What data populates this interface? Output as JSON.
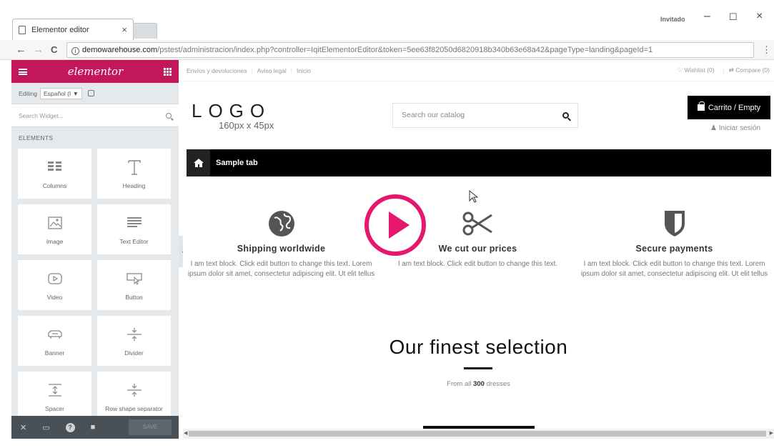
{
  "browser": {
    "tab_title": "Elementor editor",
    "tab_close": "×",
    "user_label": "Invitado",
    "window_minimize": "–",
    "window_maximize": "☐",
    "window_close": "×",
    "back": "←",
    "forward": "→",
    "reload": "C",
    "url_host": "demowarehouse.com",
    "url_path": "/pstest/administracion/index.php?controller=IqitElementorEditor&token=5ee63f82050d6820918b340b63e68a42&pageType=landing&pageId=1",
    "menu": "⋮"
  },
  "panel": {
    "brand": "elementor",
    "editing_label": "Editing",
    "language": "Español (I ▼",
    "search_placeholder": "Search Widget...",
    "section_title": "ELEMENTS",
    "widgets": [
      {
        "label": "Columns",
        "icon": "columns-icon"
      },
      {
        "label": "Heading",
        "icon": "heading-icon"
      },
      {
        "label": "Image",
        "icon": "image-icon"
      },
      {
        "label": "Text Editor",
        "icon": "text-editor-icon"
      },
      {
        "label": "Video",
        "icon": "video-icon"
      },
      {
        "label": "Button",
        "icon": "button-icon"
      },
      {
        "label": "Banner",
        "icon": "banner-icon"
      },
      {
        "label": "Divider",
        "icon": "divider-icon"
      },
      {
        "label": "Spacer",
        "icon": "spacer-icon"
      },
      {
        "label": "Row shape separator",
        "icon": "row-shape-separator-icon"
      }
    ],
    "footer": {
      "close": "✕",
      "responsive": "▭",
      "help": "?",
      "folder": "■",
      "save": "SAVE"
    },
    "collapse": "‹"
  },
  "site": {
    "topnav": [
      "Envíos y devoluciones",
      "Aviso legal",
      "Inicio"
    ],
    "wishlist": "♡ Wishlist (0)",
    "compare": "⇄ Compare (0)",
    "logo": "LOGO",
    "logo_size": "160px x 45px",
    "search_placeholder": "Search our catalog",
    "cart": "Carrito / Empty",
    "login": "Iniciar sesión",
    "tab_label": "Sample tab",
    "features": [
      {
        "title": "Shipping worldwide",
        "text": "I am text block. Click edit button to change this text. Lorem ipsum dolor sit amet, consectetur adipiscing elit. Ut elit tellus",
        "icon": "globe-icon"
      },
      {
        "title": "We cut our prices",
        "text": "I am text block. Click edit button to change this text.",
        "icon": "scissors-icon"
      },
      {
        "title": "Secure payments",
        "text": "I am text block. Click edit button to change this text. Lorem ipsum dolor sit amet, consectetur adipiscing elit. Ut elit tellus",
        "icon": "shield-icon"
      }
    ],
    "finest_title": "Our finest selection",
    "finest_prefix": "From all",
    "finest_count": "300",
    "finest_suffix": "dresses"
  },
  "colors": {
    "elementor_brand": "#c2185b",
    "play_button": "#e5176f",
    "panel_bg": "#e6e9ec",
    "panel_footer": "#495157"
  }
}
